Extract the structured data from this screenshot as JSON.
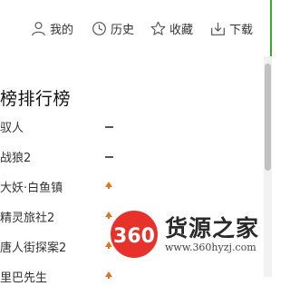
{
  "nav": {
    "mine": "我的",
    "history": "历史",
    "favorites": "收藏",
    "download": "下载"
  },
  "ranking": {
    "title": "榜排行榜",
    "items": [
      {
        "name": "驭人",
        "trend": "flat"
      },
      {
        "name": "战狼2",
        "trend": "flat"
      },
      {
        "name": "大妖·白鱼镇",
        "trend": "up"
      },
      {
        "name": "精灵旅社2",
        "trend": "up"
      },
      {
        "name": "唐人街探案2",
        "trend": "up"
      },
      {
        "name": "里巴先生",
        "trend": "up"
      }
    ]
  },
  "watermark": {
    "logo_text": "360",
    "brand": "货源之家",
    "url": "www.360hyzj.com"
  },
  "colors": {
    "accent_green": "#3aa82f",
    "trend_up": "#e0761c",
    "logo_red": "#e8312a"
  }
}
